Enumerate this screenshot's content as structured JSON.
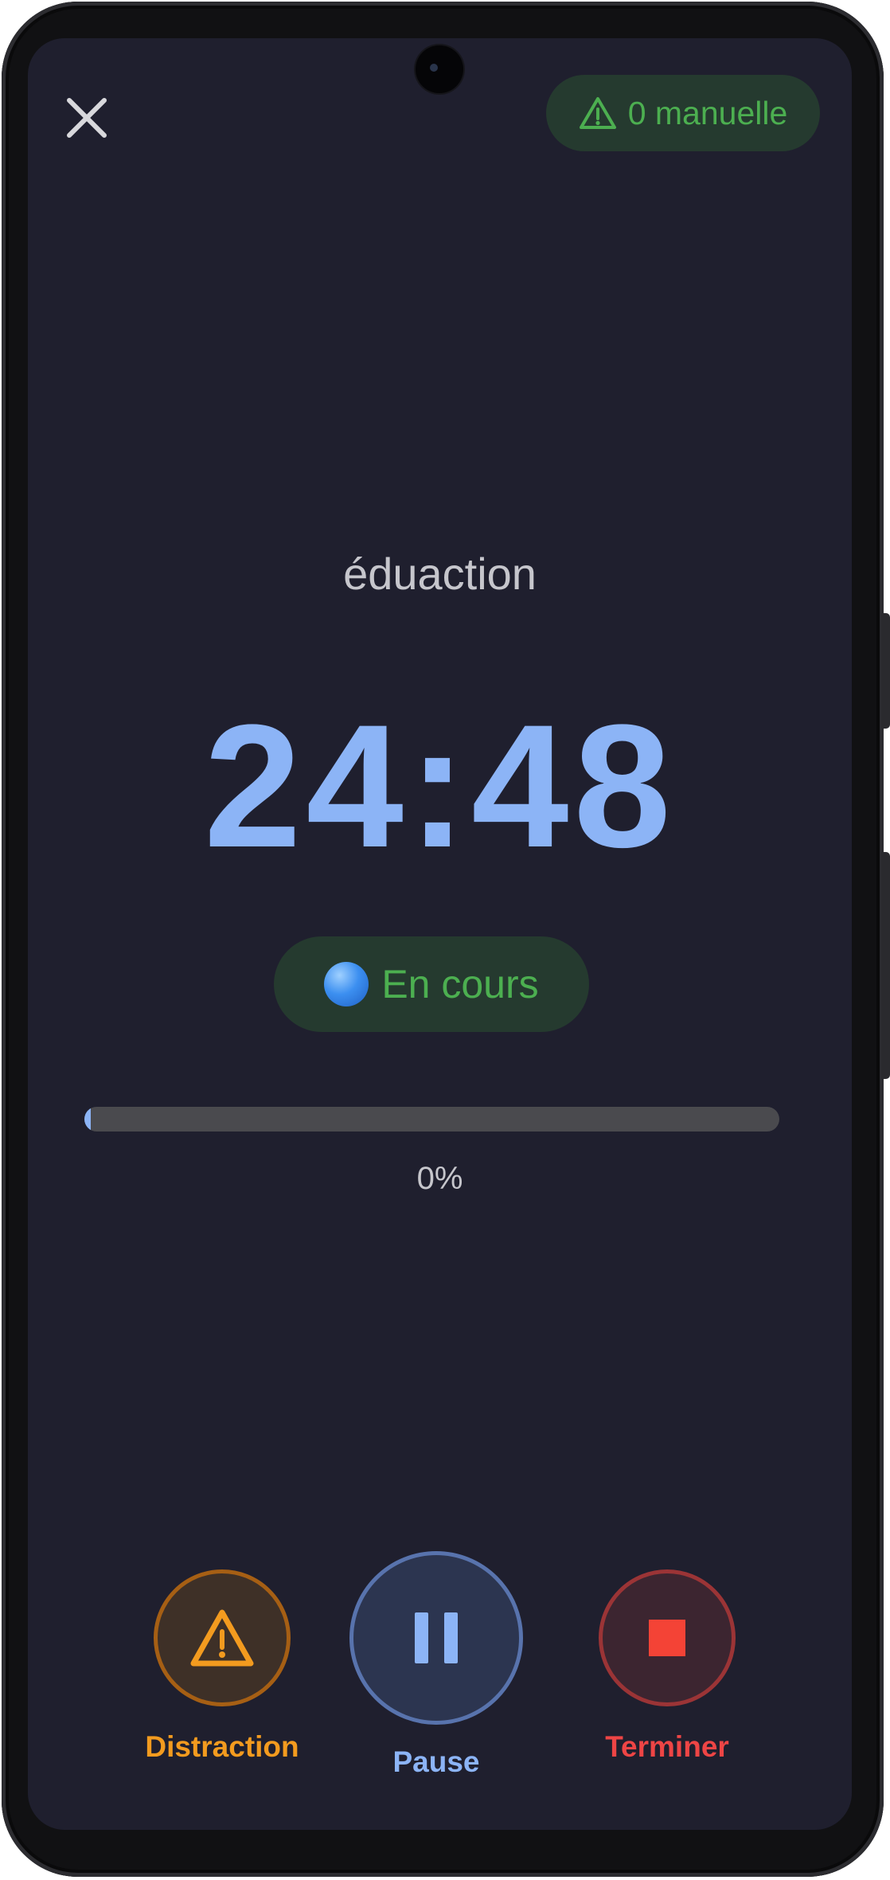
{
  "header": {
    "close_icon": "close-icon",
    "manual_badge": {
      "icon": "warning-triangle-icon",
      "label": "0 manuelle"
    }
  },
  "session": {
    "title": "éduaction",
    "timer": "24:48",
    "status": {
      "icon": "blue-circle-icon",
      "label": "En cours"
    },
    "progress": {
      "value_percent": 0,
      "label": "0%"
    }
  },
  "actions": [
    {
      "label": "Distraction",
      "icon": "warning-triangle-icon",
      "color": "#f39b1f"
    },
    {
      "label": "Pause",
      "icon": "pause-icon",
      "color": "#8cb4f6"
    },
    {
      "label": "Terminer",
      "icon": "stop-icon",
      "color": "#ee4545"
    }
  ],
  "colors": {
    "background": "#1f1f2e",
    "accent": "#8cb4f6",
    "success": "#4caf50",
    "warning": "#f39b1f",
    "danger": "#ee4545"
  }
}
